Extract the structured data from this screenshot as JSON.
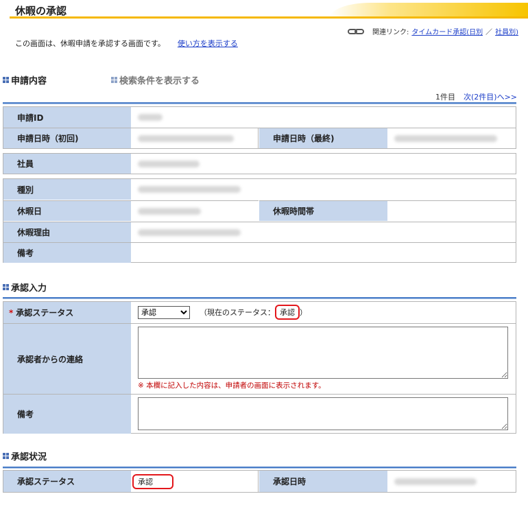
{
  "header": {
    "title": "休暇の承認",
    "related_label": "関連リンク:",
    "related_link1": "タイムカード承認(日別",
    "related_sep": "／",
    "related_link2": "社員別)"
  },
  "description": {
    "text": "この画面は、休暇申請を承認する画面です。",
    "help_link": "使い方を表示する"
  },
  "section_request": {
    "title": "申請内容",
    "search_toggle": "検索条件を表示する",
    "pager_count": "1件目",
    "pager_next": "次(2件目)へ>>",
    "labels": {
      "request_id": "申請ID",
      "request_date_first": "申請日時（初回)",
      "request_date_last": "申請日時（最終)",
      "employee": "社員",
      "type": "種別",
      "leave_date": "休暇日",
      "leave_time": "休暇時間帯",
      "reason": "休暇理由",
      "remarks": "備考"
    }
  },
  "section_input": {
    "title": "承認入力",
    "status_label": "承認ステータス",
    "status_options": [
      "承認"
    ],
    "status_selected": "承認",
    "current_status_prefix": "（現在のステータス：",
    "current_status_value": "承認",
    "current_status_suffix": "）",
    "message_label": "承認者からの連絡",
    "message_value": "",
    "message_note": "※ 本欄に記入した内容は、申請者の画面に表示されます。",
    "remarks_label": "備考",
    "remarks_value": ""
  },
  "section_status": {
    "title": "承認状況",
    "status_label": "承認ステータス",
    "status_value": "承認",
    "date_label": "承認日時"
  },
  "colors": {
    "accent_yellow": "#f5b800",
    "label_bg": "#c6d6ec",
    "rule_blue": "#4a7dc8",
    "highlight_red": "#e3161b",
    "link_blue": "#1a3cc8"
  }
}
